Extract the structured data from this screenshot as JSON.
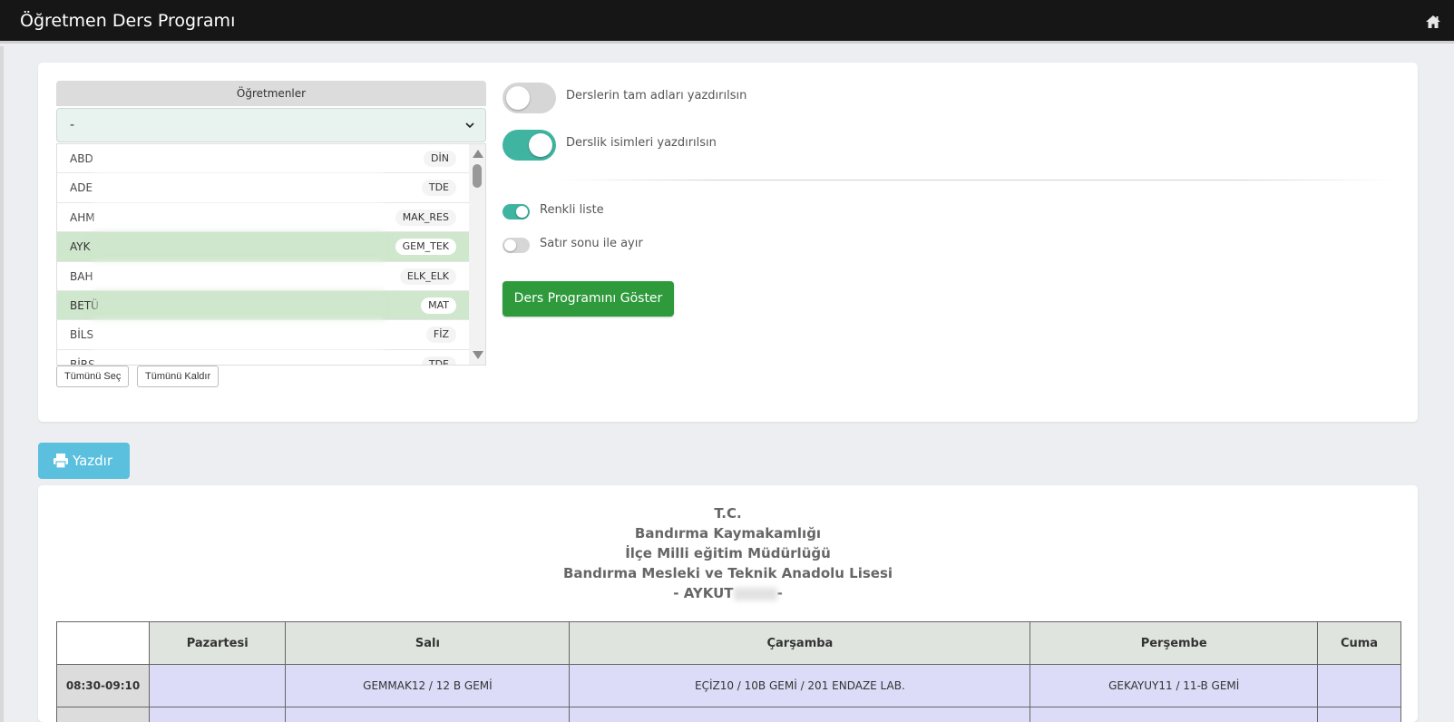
{
  "header": {
    "title": "Öğretmen Ders Programı",
    "home_icon": "home-icon"
  },
  "teachers": {
    "header": "Öğretmenler",
    "select_value": "-",
    "items": [
      {
        "name": "ABD",
        "tag": "DİN",
        "selected": false
      },
      {
        "name": "ADE",
        "tag": "TDE",
        "selected": false
      },
      {
        "name": "AHM",
        "tag": "MAK_RES",
        "selected": false
      },
      {
        "name": "AYK",
        "tag": "GEM_TEK",
        "selected": true
      },
      {
        "name": "BAH",
        "tag": "ELK_ELK",
        "selected": false
      },
      {
        "name": "BETÜ",
        "tag": "MAT",
        "selected": true
      },
      {
        "name": "BİLS",
        "tag": "FİZ",
        "selected": false
      },
      {
        "name": "BİRS",
        "tag": "TDE",
        "selected": false
      }
    ],
    "select_all": "Tümünü Seç",
    "clear_all": "Tümünü Kaldır"
  },
  "options": {
    "full_names": {
      "label": "Derslerin tam adları yazdırılsın",
      "on": false
    },
    "room_names": {
      "label": "Derslik isimleri yazdırılsın",
      "on": true
    },
    "colored_list": {
      "label": "Renkli liste",
      "on": true
    },
    "line_break": {
      "label": "Satır sonu ile ayır",
      "on": false
    }
  },
  "show_button": "Ders Programını Göster",
  "print_button": "Yazdır",
  "report": {
    "line1": "T.C.",
    "line2": "Bandırma Kaymakamlığı",
    "line3": "İlçe Milli eğitim Müdürlüğü",
    "line4": "Bandırma Mesleki ve Teknik Anadolu Lisesi",
    "teacher_prefix": "- AYKUT",
    "teacher_suffix": "-"
  },
  "schedule": {
    "days": [
      "Pazartesi",
      "Salı",
      "Çarşamba",
      "Perşembe",
      "Cuma"
    ],
    "rows": [
      {
        "time": "08:30-09:10",
        "cells": [
          "",
          "GEMMAK12 / 12 B GEMİ",
          "EÇİZ10 / 10B GEMİ / 201 ENDAZE LAB.",
          "GEKAYUY11 / 11-B GEMİ",
          ""
        ]
      },
      {
        "time": "",
        "cells": [
          "",
          "",
          "",
          "",
          ""
        ]
      }
    ]
  },
  "colors": {
    "accent": "#3fb4a0",
    "primary": "#2e9a3c",
    "print": "#5bc0de",
    "topbar": "#161616"
  }
}
